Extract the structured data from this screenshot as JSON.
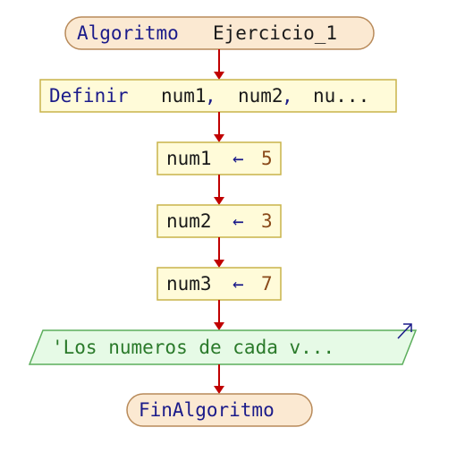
{
  "colors": {
    "keyword": "#1b1b8a",
    "identifier": "#1a1a1a",
    "number": "#8a4a1a",
    "string": "#2a7a2a",
    "arrow": "#c00000",
    "terminal_fill": "#fbe9d2",
    "terminal_stroke": "#b88a5a",
    "process_fill": "#fffbd9",
    "process_stroke": "#c9b34a",
    "output_fill": "#e6fae6",
    "output_stroke": "#5cae5c",
    "output_marker": "#1b1b8a"
  },
  "flowchart": {
    "start": {
      "keyword": "Algoritmo",
      "name": "Ejercicio_1"
    },
    "define": {
      "keyword": "Definir",
      "vars_a": "num1",
      "sep_a": ",",
      "vars_b": "num2",
      "sep_b": ",",
      "vars_c": "nu...",
      "ellipsis_note": ""
    },
    "assign_1": {
      "var": "num1",
      "op": "←",
      "value": "5"
    },
    "assign_2": {
      "var": "num2",
      "op": "←",
      "value": "3"
    },
    "assign_3": {
      "var": "num3",
      "op": "←",
      "value": "7"
    },
    "output": {
      "text": "'Los numeros de cada v...",
      "icon": "output-arrow-icon"
    },
    "end": {
      "keyword": "FinAlgoritmo"
    }
  }
}
